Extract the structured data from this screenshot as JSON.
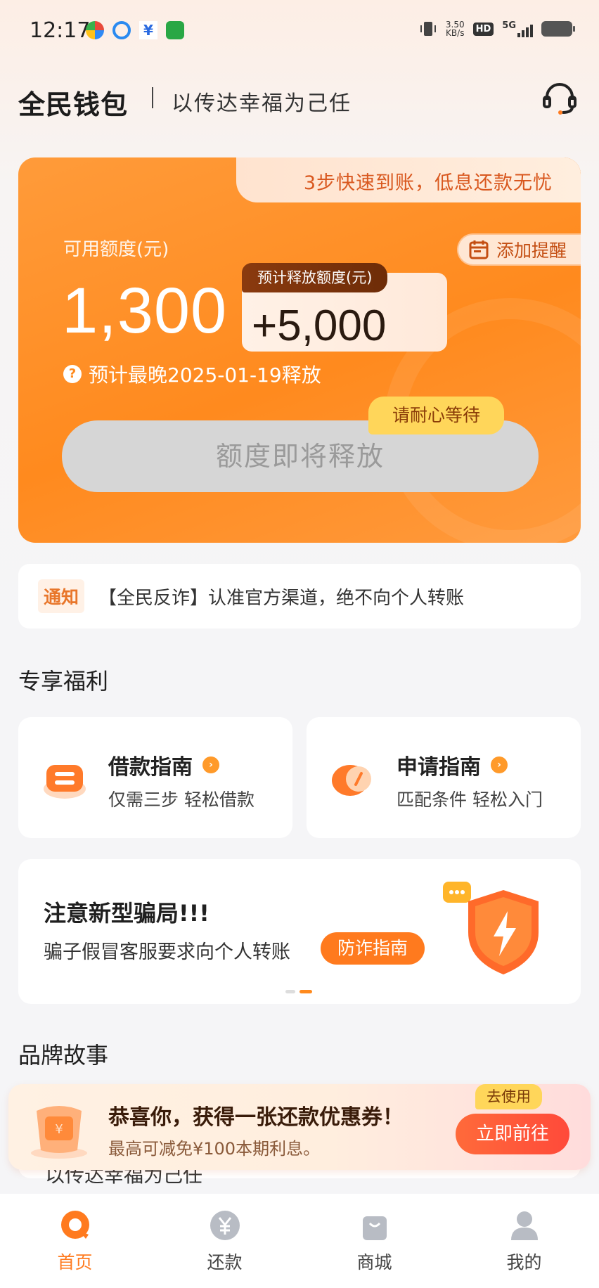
{
  "status_bar": {
    "time": "12:17",
    "net_speed_value": "3.50",
    "net_speed_unit": "KB/s",
    "hd": "HD",
    "network": "5G"
  },
  "header": {
    "brand": "全民钱包",
    "slogan": "以传达幸福为己任",
    "service_icon": "headset-icon"
  },
  "credit_card": {
    "tab_text": "3步快速到账，低息还款无忧",
    "available_label": "可用额度(元)",
    "available_amount": "1,300",
    "release_tag": "预计释放额度(元)",
    "release_amount": "+5,000",
    "remind_label": "添加提醒",
    "release_date_text": "预计最晚2025-01-19释放",
    "wait_badge": "请耐心等待",
    "release_button": "额度即将释放"
  },
  "notice": {
    "tag": "通知",
    "text": "【全民反诈】认准官方渠道，绝不向个人转账"
  },
  "benefits": {
    "title": "专享福利",
    "cards": [
      {
        "title": "借款指南",
        "subtitle": "仅需三步 轻松借款",
        "icon": "loan-guide-icon"
      },
      {
        "title": "申请指南",
        "subtitle": "匹配条件 轻松入门",
        "icon": "apply-guide-icon"
      }
    ]
  },
  "scam_banner": {
    "title": "注意新型骗局!!!",
    "subtitle": "骗子假冒客服要求向个人转账",
    "button": "防诈指南",
    "icon": "shield-lightning-icon"
  },
  "brand_story": {
    "title": "品牌故事",
    "partial_text": "以传达幸福为己任"
  },
  "coupon_popup": {
    "title": "恭喜你，获得一张还款优惠券！",
    "subtitle": "最高可减免¥100本期利息。",
    "use_tag": "去使用",
    "go_button": "立即前往"
  },
  "tab_bar": {
    "items": [
      {
        "label": "首页",
        "icon": "home-icon",
        "active": true
      },
      {
        "label": "还款",
        "icon": "yen-coin-icon",
        "active": false
      },
      {
        "label": "商城",
        "icon": "shopping-bag-icon",
        "active": false
      },
      {
        "label": "我的",
        "icon": "user-icon",
        "active": false
      }
    ]
  },
  "colors": {
    "accent": "#ff8a1e",
    "accent_dark": "#ff7a1e",
    "tab_active": "#ff7a1e",
    "release_button_bg": "#d6d6d6"
  }
}
